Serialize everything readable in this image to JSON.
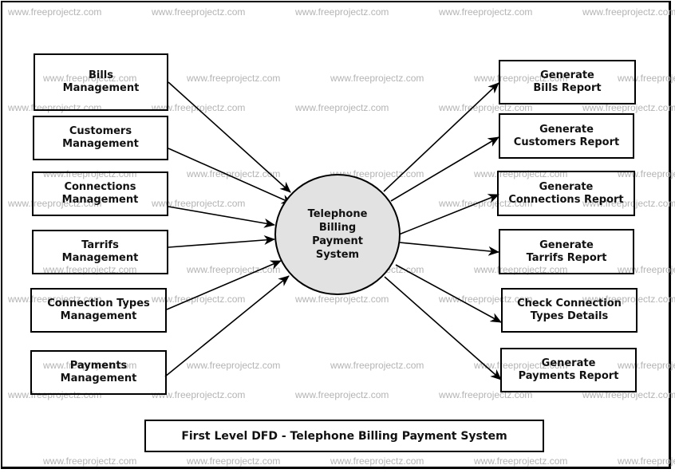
{
  "diagram": {
    "title": "First Level DFD - Telephone Billing Payment System",
    "process": {
      "label": "Telephone\nBilling\nPayment\nSystem",
      "fill": "#e2e2e2"
    },
    "inputs": [
      {
        "label": "Bills\nManagement"
      },
      {
        "label": "Customers\nManagement"
      },
      {
        "label": "Connections\nManagement"
      },
      {
        "label": "Tarrifs\nManagement"
      },
      {
        "label": "Connection Types\nManagement"
      },
      {
        "label": "Payments\nManagement"
      }
    ],
    "outputs": [
      {
        "label": "Generate\nBills Report"
      },
      {
        "label": "Generate\nCustomers Report"
      },
      {
        "label": "Generate\nConnections Report"
      },
      {
        "label": "Generate\nTarrifs Report"
      },
      {
        "label": "Check Connection\nTypes Details"
      },
      {
        "label": "Generate\nPayments Report"
      }
    ],
    "flows": [
      {
        "from": "Bills Management",
        "to": "process"
      },
      {
        "from": "Customers Management",
        "to": "process"
      },
      {
        "from": "Connections Management",
        "to": "process"
      },
      {
        "from": "Tarrifs Management",
        "to": "process"
      },
      {
        "from": "Connection Types Management",
        "to": "process"
      },
      {
        "from": "Payments Management",
        "to": "process"
      },
      {
        "from": "process",
        "to": "Generate Bills Report"
      },
      {
        "from": "process",
        "to": "Generate Customers Report"
      },
      {
        "from": "process",
        "to": "Generate Connections Report"
      },
      {
        "from": "process",
        "to": "Generate Tarrifs Report"
      },
      {
        "from": "process",
        "to": "Check Connection Types Details"
      },
      {
        "from": "process",
        "to": "Generate Payments Report"
      }
    ]
  },
  "watermark": {
    "text": "www.freeprojectz.com",
    "color": "#b4b4b4"
  }
}
